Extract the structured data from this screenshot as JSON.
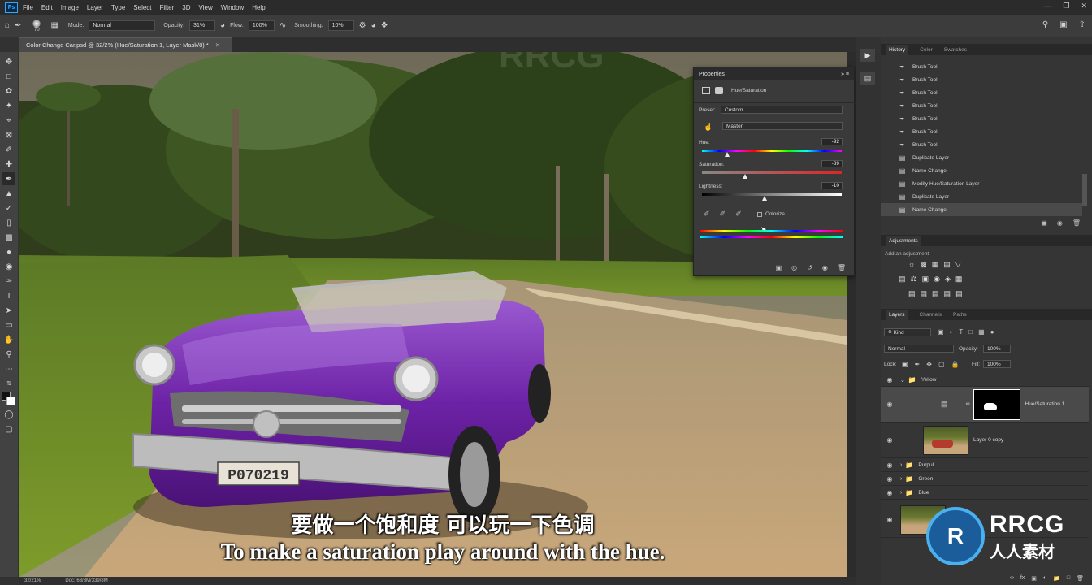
{
  "menubar": {
    "app_icon": "Ps",
    "items": [
      "File",
      "Edit",
      "Image",
      "Layer",
      "Type",
      "Select",
      "Filter",
      "3D",
      "View",
      "Window",
      "Help"
    ]
  },
  "options_bar": {
    "brush_size": "70",
    "mode_label": "Mode:",
    "mode_value": "Normal",
    "opacity_label": "Opacity:",
    "opacity_value": "31%",
    "flow_label": "Flow:",
    "flow_value": "100%",
    "smoothing_label": "Smoothing:",
    "smoothing_value": "10%"
  },
  "document": {
    "tab_title": "Color Change Car.psd @ 32/2% (Hue/Saturation 1, Layer Mask/8) *",
    "zoom": "32/21%",
    "doc_info": "Doc: 63/3M/339/8M"
  },
  "properties": {
    "title": "Properties",
    "subtitle": "Hue/Saturation",
    "preset_label": "Preset:",
    "preset_value": "Custom",
    "channel_value": "Master",
    "hue_label": "Hue:",
    "hue_value": "-92",
    "saturation_label": "Saturation:",
    "saturation_value": "-39",
    "lightness_label": "Lightness:",
    "lightness_value": "-10",
    "colorize_label": "Colorize",
    "hue_fraction": 0.18,
    "saturation_fraction": 0.31,
    "lightness_fraction": 0.45
  },
  "history": {
    "tabs": [
      "History",
      "Color",
      "Swatches"
    ],
    "items": [
      {
        "icon": "brush",
        "label": "Brush Tool"
      },
      {
        "icon": "brush",
        "label": "Brush Tool"
      },
      {
        "icon": "brush",
        "label": "Brush Tool"
      },
      {
        "icon": "brush",
        "label": "Brush Tool"
      },
      {
        "icon": "brush",
        "label": "Brush Tool"
      },
      {
        "icon": "brush",
        "label": "Brush Tool"
      },
      {
        "icon": "brush",
        "label": "Brush Tool"
      },
      {
        "icon": "doc",
        "label": "Duplicate Layer"
      },
      {
        "icon": "doc",
        "label": "Name Change"
      },
      {
        "icon": "doc",
        "label": "Modify Hue/Saturation Layer"
      },
      {
        "icon": "doc",
        "label": "Duplicate Layer"
      },
      {
        "icon": "doc",
        "label": "Name Change"
      }
    ]
  },
  "adjustments": {
    "title": "Adjustments",
    "hint": "Add an adjustment"
  },
  "layers": {
    "tabs": [
      "Layers",
      "Channels",
      "Paths"
    ],
    "kind_label": "Kind",
    "blend_mode": "Normal",
    "opacity_label": "Opacity:",
    "opacity_value": "100%",
    "lock_label": "Lock:",
    "fill_label": "Fill:",
    "fill_value": "100%",
    "items": [
      {
        "type": "group",
        "name": "Yellow"
      },
      {
        "type": "adjustment",
        "name": "Hue/Saturation 1"
      },
      {
        "type": "pixel",
        "name": "Layer 0 copy"
      },
      {
        "type": "group",
        "name": "Purpul"
      },
      {
        "type": "group",
        "name": "Green"
      },
      {
        "type": "group",
        "name": "Blue"
      }
    ]
  },
  "subtitles": {
    "chinese": "要做一个饱和度 可以玩一下色调",
    "english": "To make a saturation play around with the hue."
  },
  "watermark": {
    "brand": "RRCG",
    "brand_cn": "人人素材",
    "plate": "P070219"
  },
  "colors": {
    "accent": "#31a8ff",
    "car": "#7a2fb0",
    "panel": "#353535"
  }
}
